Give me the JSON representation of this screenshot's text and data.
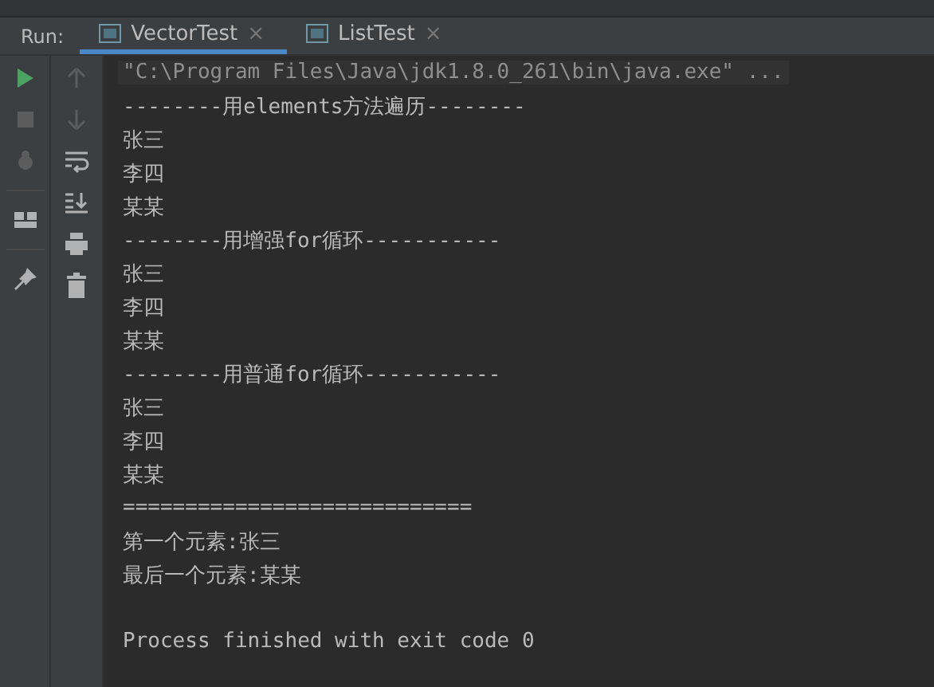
{
  "run_panel": {
    "label": "Run:"
  },
  "tabs": [
    {
      "label": "VectorTest",
      "selected": true,
      "close": "×"
    },
    {
      "label": "ListTest",
      "selected": false,
      "close": "×"
    }
  ],
  "toolbar_left": [
    {
      "kind": "run",
      "disabled": false
    },
    {
      "kind": "stop",
      "disabled": true
    },
    {
      "kind": "debug",
      "disabled": true
    },
    {
      "kind": "separator"
    },
    {
      "kind": "layout",
      "disabled": false
    },
    {
      "kind": "separator"
    },
    {
      "kind": "pin",
      "disabled": false
    }
  ],
  "toolbar_right": [
    {
      "kind": "up",
      "disabled": true
    },
    {
      "kind": "down",
      "disabled": true
    },
    {
      "kind": "wrap",
      "disabled": false
    },
    {
      "kind": "scroll-end",
      "disabled": false
    },
    {
      "kind": "print",
      "disabled": false
    },
    {
      "kind": "trash",
      "disabled": false
    }
  ],
  "console": [
    {
      "kind": "command",
      "text": "\"C:\\Program Files\\Java\\jdk1.8.0_261\\bin\\java.exe\" ..."
    },
    {
      "kind": "output",
      "text": "--------用elements方法遍历--------"
    },
    {
      "kind": "output",
      "text": "张三"
    },
    {
      "kind": "output",
      "text": "李四"
    },
    {
      "kind": "output",
      "text": "某某"
    },
    {
      "kind": "output",
      "text": "--------用增强for循环-----------"
    },
    {
      "kind": "output",
      "text": "张三"
    },
    {
      "kind": "output",
      "text": "李四"
    },
    {
      "kind": "output",
      "text": "某某"
    },
    {
      "kind": "output",
      "text": "--------用普通for循环-----------"
    },
    {
      "kind": "output",
      "text": "张三"
    },
    {
      "kind": "output",
      "text": "李四"
    },
    {
      "kind": "output",
      "text": "某某"
    },
    {
      "kind": "output",
      "text": "============================"
    },
    {
      "kind": "output",
      "text": "第一个元素:张三"
    },
    {
      "kind": "output",
      "text": "最后一个元素:某某"
    },
    {
      "kind": "blank"
    },
    {
      "kind": "exit",
      "text": "Process finished with exit code 0"
    }
  ]
}
